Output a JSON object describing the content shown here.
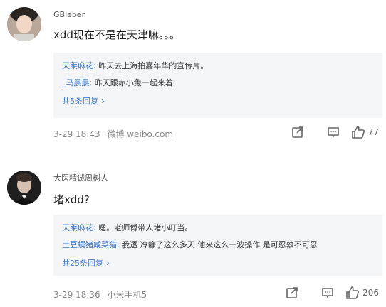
{
  "comments": [
    {
      "username": "GBleber",
      "content": "xdd现在不是在天津嘛。。。",
      "replies": [
        {
          "user": "天莱麻花",
          "text": "昨天去上海拍嘉年华的宣传片。"
        },
        {
          "user": "_马晨晨",
          "text": "昨天跟赤小兔一起来着"
        }
      ],
      "more": "共5条回复",
      "time": "3-29 18:43",
      "source": "微博 weibo.com",
      "likes": "77",
      "icons": {
        "share": "share-icon",
        "comment": "comment-icon",
        "like": "thumbs-up-icon"
      }
    },
    {
      "username": "大医精诚周树人",
      "content": "堵xdd?",
      "replies": [
        {
          "user": "天莱麻花",
          "text": "嗯。老师傅带人堵小叮当。"
        },
        {
          "user": "土豆蜗猪咸菜猫",
          "text": "我透 冷静了这么多天 他来这么一波操作 是可忍孰不可忍"
        }
      ],
      "more": "共25条回复",
      "time": "3-29 18:36",
      "source": "小米手机5",
      "likes": "206",
      "icons": {
        "share": "share-icon",
        "comment": "comment-icon",
        "like": "thumbs-up-icon"
      }
    }
  ],
  "colors": {
    "link": "#3b74c3",
    "reply_bg": "#f4f5f7",
    "meta": "#888888"
  }
}
